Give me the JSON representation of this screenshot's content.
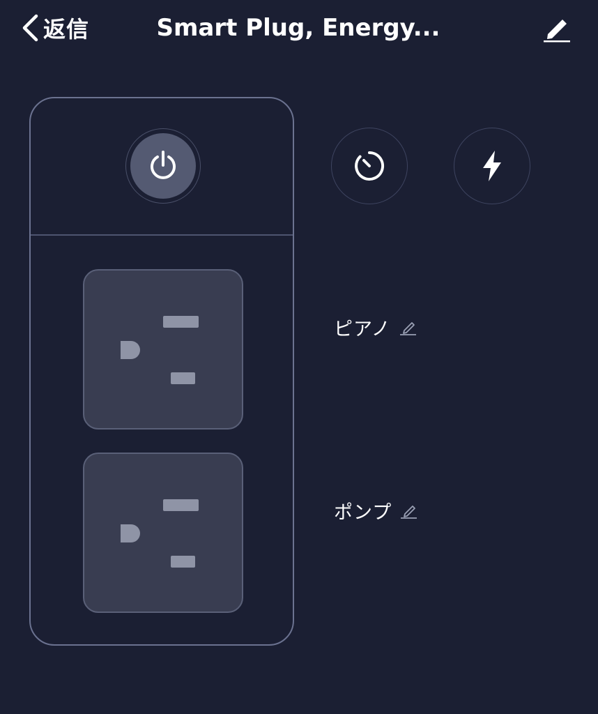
{
  "header": {
    "back_label": "返信",
    "title": "Smart Plug, Energy..."
  },
  "outlets": [
    {
      "name": "ピアノ"
    },
    {
      "name": "ポンプ"
    }
  ],
  "icons": {
    "back": "chevron-left-icon",
    "edit": "pencil-icon",
    "power": "power-icon",
    "timer": "timer-icon",
    "energy": "lightning-bolt-icon",
    "rename": "pencil-icon"
  },
  "colors": {
    "background": "#1b1f33",
    "panel_border": "#6b7290",
    "outlet_fill": "#393d51",
    "slot": "#8f94a6",
    "power_button": "#545a72"
  }
}
